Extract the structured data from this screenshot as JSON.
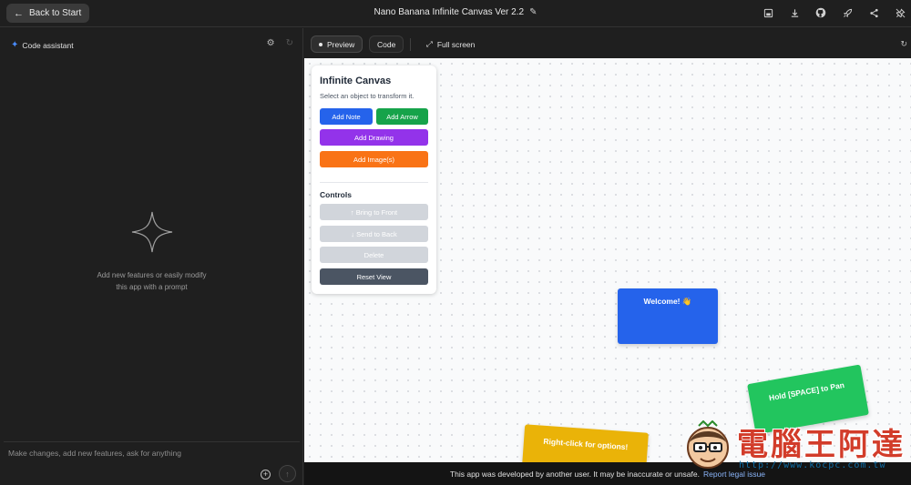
{
  "topbar": {
    "back_label": "Back to Start",
    "title": "Nano Banana Infinite Canvas Ver 2.2",
    "icons": [
      "save-icon",
      "download-icon",
      "github-icon",
      "rocket-icon",
      "share-icon",
      "unpin-icon"
    ]
  },
  "assistant": {
    "header": "Code assistant",
    "empty_line1": "Add new features or easily modify",
    "empty_line2": "this app with a prompt",
    "prompt_placeholder": "Make changes, add new features, ask for anything"
  },
  "toolbar": {
    "preview_label": "Preview",
    "code_label": "Code",
    "fullscreen_label": "Full screen"
  },
  "canvas_panel": {
    "title": "Infinite Canvas",
    "subtitle": "Select an object to transform it.",
    "add_note": "Add Note",
    "add_arrow": "Add Arrow",
    "add_drawing": "Add Drawing",
    "add_images": "Add Image(s)",
    "controls_heading": "Controls",
    "bring_front": "↑ Bring to Front",
    "send_back": "↓ Send to Back",
    "delete": "Delete",
    "reset_view": "Reset View"
  },
  "notes": {
    "welcome": "Welcome! 👋",
    "space": "Hold [SPACE] to Pan",
    "right_click": "Right-click for options!"
  },
  "notice": {
    "text": "This app was developed by another user. It may be inaccurate or unsafe.",
    "link": "Report legal issue"
  },
  "watermark": {
    "text": "電腦王阿達",
    "url": "http://www.kocpc.com.tw"
  },
  "colors": {
    "blue": "#2563eb",
    "green": "#16a34a",
    "purple": "#9333ea",
    "orange": "#f97316",
    "disabled": "#d1d5db",
    "slate": "#4b5563",
    "note_green": "#22c55e",
    "note_yellow": "#eab308"
  }
}
